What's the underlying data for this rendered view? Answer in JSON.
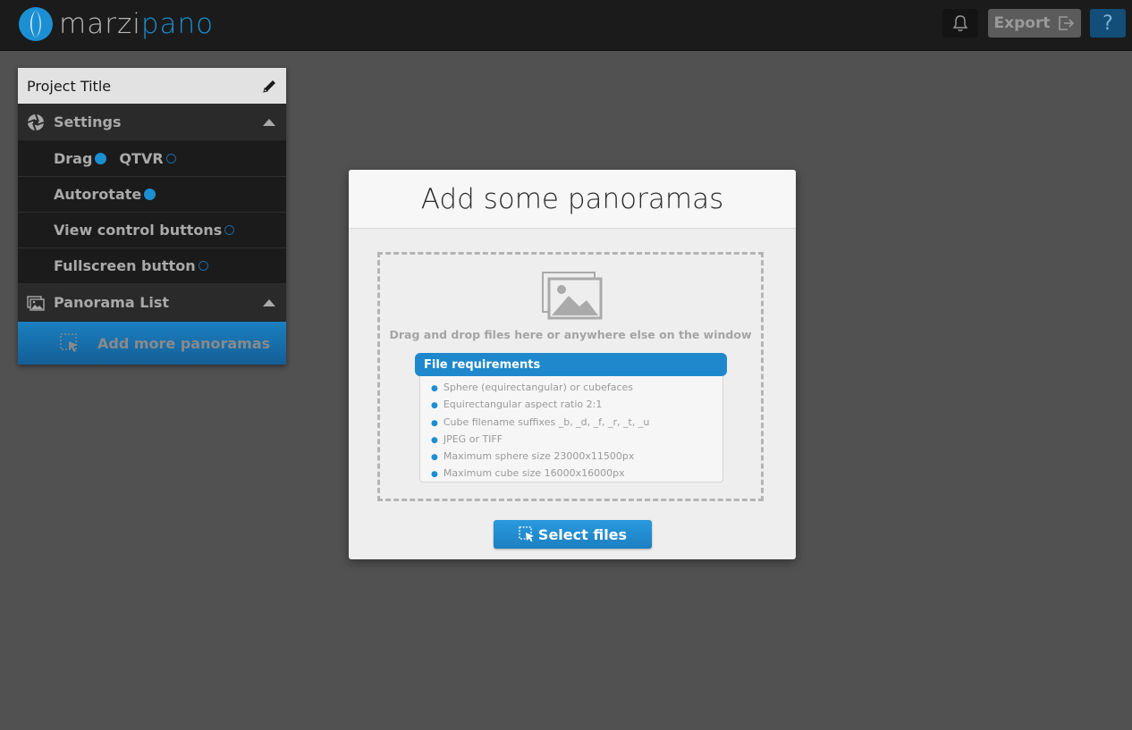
{
  "header": {
    "logo_text_a": "marzi",
    "logo_text_b": "pano",
    "export_label": "Export",
    "help_label": "?"
  },
  "sidebar": {
    "project_title": "Project Title",
    "settings_label": "Settings",
    "options": {
      "drag_label": "Drag",
      "drag_selected": true,
      "qtvr_label": "QTVR",
      "qtvr_selected": false,
      "autorotate_label": "Autorotate",
      "autorotate_on": true,
      "view_control_label": "View control buttons",
      "view_control_on": false,
      "fullscreen_label": "Fullscreen button",
      "fullscreen_on": false
    },
    "panorama_list_label": "Panorama List",
    "add_more_label": "Add more panoramas"
  },
  "modal": {
    "title": "Add some panoramas",
    "drop_text": "Drag and drop files here or anywhere else on the window",
    "requirements_title": "File requirements",
    "requirements": [
      "Sphere (equirectangular) or cubefaces",
      "Equirectangular aspect ratio 2:1",
      "Cube filename suffixes _b, _d, _f, _r, _t, _u",
      "JPEG or TIFF",
      "Maximum sphere size 23000x11500px",
      "Maximum cube size 16000x16000px"
    ],
    "select_label": "Select files"
  },
  "icons": {
    "logo": "marzipano-logo-icon",
    "notifications": "bell-icon",
    "export": "export-icon",
    "edit": "pencil-icon",
    "settings": "aperture-icon",
    "panorama_list": "images-icon",
    "add": "select-cursor-icon",
    "drop": "image-stack-icon"
  },
  "colors": {
    "accent": "#1b8fd2",
    "topbar": "#1b1b1b",
    "background": "#515151"
  }
}
